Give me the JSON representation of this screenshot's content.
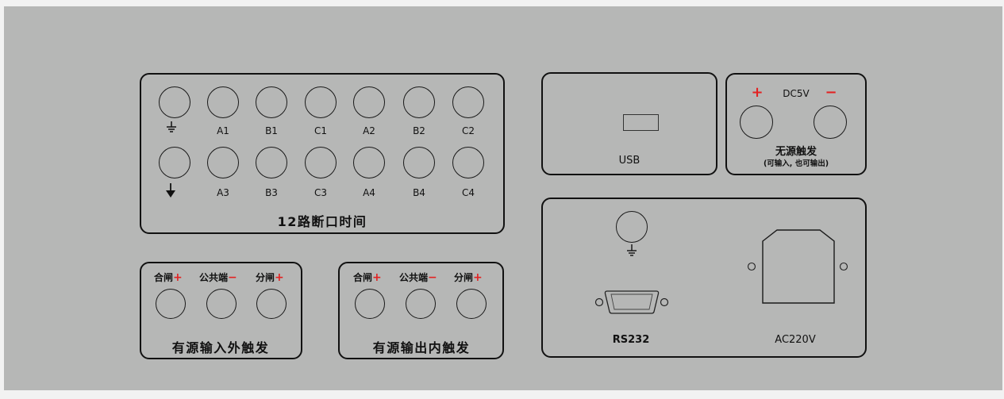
{
  "break_time_section": {
    "title": "12路断口时间",
    "top_row_labels": [
      "A1",
      "B1",
      "C1",
      "A2",
      "B2",
      "C2"
    ],
    "bottom_row_labels": [
      "A3",
      "B3",
      "C3",
      "A4",
      "B4",
      "C4"
    ],
    "ground_icon": "ground-icon",
    "trigger_icon": "down-arrow-icon"
  },
  "ext_trigger_section": {
    "title": "有源输入外触发",
    "labels": [
      "合闸",
      "公共端",
      "分闸"
    ],
    "signs": [
      "+",
      "−",
      "+"
    ]
  },
  "int_trigger_section": {
    "title": "有源输出内触发",
    "labels": [
      "合闸",
      "公共端",
      "分闸"
    ],
    "signs": [
      "+",
      "−",
      "+"
    ]
  },
  "usb_section": {
    "label": "USB"
  },
  "dc_section": {
    "plus": "+",
    "voltage": "DC5V",
    "minus": "−",
    "title": "无源触发",
    "subtitle": "(可输入, 也可输出)"
  },
  "power_section": {
    "rs232_label": "RS232",
    "ac_label": "AC220V",
    "ground_icon": "ground-icon"
  },
  "colors": {
    "panel": "#b6b7b6",
    "accent_red": "#e32222",
    "stroke": "#111111"
  }
}
